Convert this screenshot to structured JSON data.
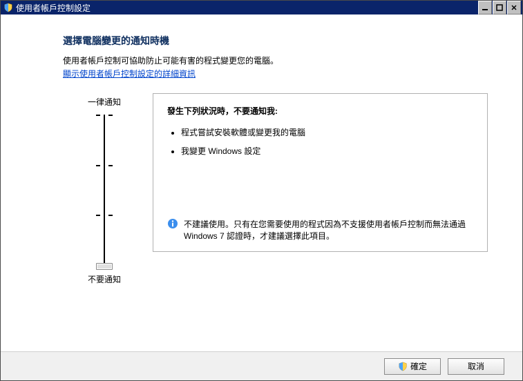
{
  "titlebar": {
    "title": "使用者帳戶控制設定"
  },
  "content": {
    "heading": "選擇電腦變更的通知時機",
    "description": "使用者帳戶控制可協助防止可能有害的程式變更您的電腦。",
    "link": "顯示使用者帳戶控制設定的詳細資訊"
  },
  "slider": {
    "top_label": "一律通知",
    "bottom_label": "不要通知",
    "level_count": 4,
    "current_level": 0
  },
  "panel": {
    "title": "發生下列狀況時，不要通知我:",
    "bullets": [
      "程式嘗試安裝軟體或變更我的電腦",
      "我變更 Windows 設定"
    ],
    "note": "不建議使用。只有在您需要使用的程式因為不支援使用者帳戶控制而無法通過 Windows 7 認證時，才建議選擇此項目。"
  },
  "buttons": {
    "ok": "確定",
    "cancel": "取消"
  }
}
